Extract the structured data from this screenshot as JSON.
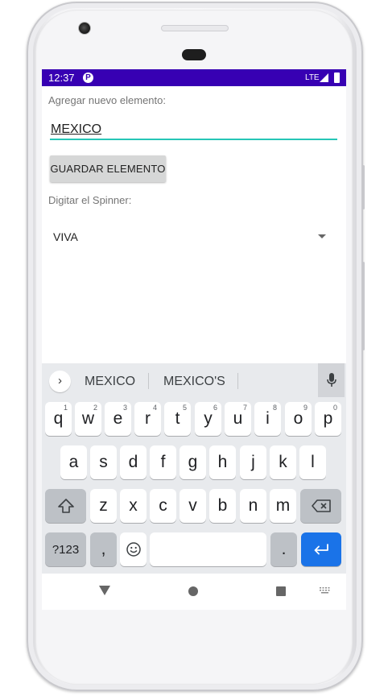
{
  "status_bar": {
    "time": "12:37",
    "app_icon_letter": "P",
    "network": "LTE"
  },
  "form": {
    "new_item_label": "Agregar nuevo elemento:",
    "new_item_value": "MEXICO",
    "save_button_label": "GUARDAR ELEMENTO",
    "spinner_label": "Digitar el Spinner:",
    "spinner_selected": "VIVA"
  },
  "keyboard": {
    "suggestions": [
      "MEXICO",
      "MEXICO'S"
    ],
    "row1": [
      {
        "key": "q",
        "hint": "1"
      },
      {
        "key": "w",
        "hint": "2"
      },
      {
        "key": "e",
        "hint": "3"
      },
      {
        "key": "r",
        "hint": "4"
      },
      {
        "key": "t",
        "hint": "5"
      },
      {
        "key": "y",
        "hint": "6"
      },
      {
        "key": "u",
        "hint": "7"
      },
      {
        "key": "i",
        "hint": "8"
      },
      {
        "key": "o",
        "hint": "9"
      },
      {
        "key": "p",
        "hint": "0"
      }
    ],
    "row2": [
      "a",
      "s",
      "d",
      "f",
      "g",
      "h",
      "j",
      "k",
      "l"
    ],
    "row3": [
      "z",
      "x",
      "c",
      "v",
      "b",
      "n",
      "m"
    ],
    "symbols_label": "?123",
    "comma_label": ",",
    "period_label": "."
  },
  "colors": {
    "status_bar": "#3700b3",
    "input_underline": "#26c6b6",
    "enter_key": "#1a73e8"
  }
}
